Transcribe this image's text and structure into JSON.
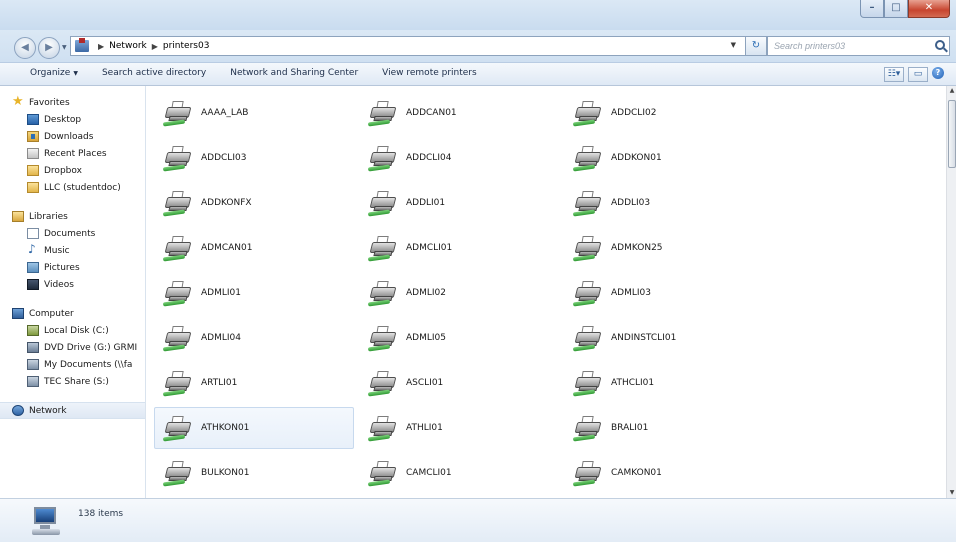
{
  "address": {
    "crumbs": [
      "Network",
      "printers03"
    ],
    "search_placeholder": "Search printers03"
  },
  "toolbar": {
    "organize": "Organize",
    "search_ad": "Search active directory",
    "network_center": "Network and Sharing Center",
    "view_remote": "View remote printers"
  },
  "nav": {
    "favorites": {
      "title": "Favorites",
      "items": [
        "Desktop",
        "Downloads",
        "Recent Places",
        "Dropbox",
        "LLC (studentdoc)"
      ]
    },
    "libraries": {
      "title": "Libraries",
      "items": [
        "Documents",
        "Music",
        "Pictures",
        "Videos"
      ]
    },
    "computer": {
      "title": "Computer",
      "items": [
        "Local Disk (C:)",
        "DVD Drive (G:) GRMI",
        "My Documents (\\\\fa",
        "TEC Share (S:)"
      ]
    },
    "network": {
      "title": "Network"
    }
  },
  "printers": [
    "AAAA_LAB",
    "ADDCAN01",
    "ADDCLI02",
    "ADDCLI03",
    "ADDCLI04",
    "ADDKON01",
    "ADDKONFX",
    "ADDLI01",
    "ADDLI03",
    "ADMCAN01",
    "ADMCLI01",
    "ADMKON25",
    "ADMLI01",
    "ADMLI02",
    "ADMLI03",
    "ADMLI04",
    "ADMLI05",
    "ANDINSTCLI01",
    "ARTLI01",
    "ASCLI01",
    "ATHCLI01",
    "ATHKON01",
    "ATHLI01",
    "BRALI01",
    "BULKON01",
    "CAMCLI01",
    "CAMKON01"
  ],
  "selected_printer": "ATHKON01",
  "details": {
    "count": "138 items"
  }
}
